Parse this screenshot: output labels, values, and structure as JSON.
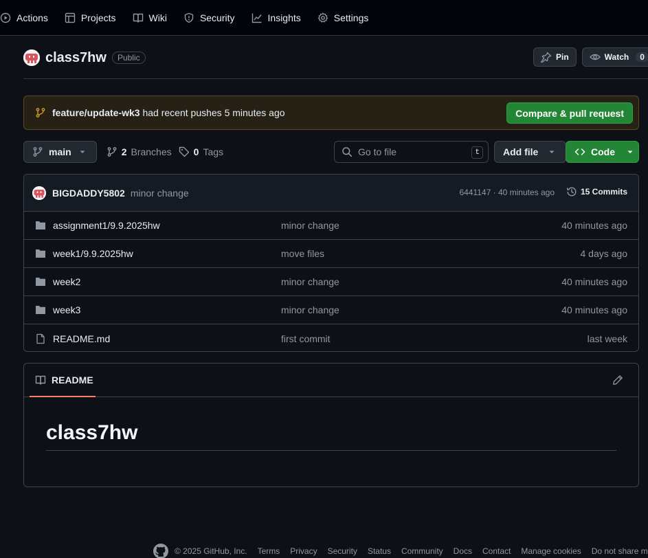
{
  "nav": {
    "items": [
      {
        "label": "Actions",
        "icon": "play-circle-icon"
      },
      {
        "label": "Projects",
        "icon": "table-icon"
      },
      {
        "label": "Wiki",
        "icon": "book-icon"
      },
      {
        "label": "Security",
        "icon": "shield-icon"
      },
      {
        "label": "Insights",
        "icon": "graph-icon"
      },
      {
        "label": "Settings",
        "icon": "gear-icon"
      }
    ]
  },
  "repo": {
    "name": "class7hw",
    "visibility": "Public",
    "pin_label": "Pin",
    "watch_label": "Watch",
    "watch_count": "0"
  },
  "push_banner": {
    "branch": "feature/update-wk3",
    "message": "had recent pushes 5 minutes ago",
    "button_label": "Compare & pull request"
  },
  "toolbar": {
    "branch": "main",
    "branches_count": "2",
    "branches_label": "Branches",
    "tags_count": "0",
    "tags_label": "Tags",
    "goto_placeholder": "Go to file",
    "goto_shortcut": "t",
    "add_file_label": "Add file",
    "code_label": "Code"
  },
  "latest_commit": {
    "author": "BIGDADDY5802",
    "message": "minor change",
    "meta": "6441147 · 40 minutes ago",
    "commits_label": "15 Commits"
  },
  "files": [
    {
      "name": "assignment1/9.9.2025hw",
      "type": "folder",
      "message": "minor change",
      "date": "40 minutes ago"
    },
    {
      "name": "week1/9.9.2025hw",
      "type": "folder",
      "message": "move files",
      "date": "4 days ago"
    },
    {
      "name": "week2",
      "type": "folder",
      "message": "minor change",
      "date": "40 minutes ago"
    },
    {
      "name": "week3",
      "type": "folder",
      "message": "minor change",
      "date": "40 minutes ago"
    },
    {
      "name": "README.md",
      "type": "file",
      "message": "first commit",
      "date": "last week"
    }
  ],
  "readme": {
    "tab_label": "README",
    "heading": "class7hw"
  },
  "footer": {
    "copyright": "© 2025 GitHub, Inc.",
    "links": [
      "Terms",
      "Privacy",
      "Security",
      "Status",
      "Community",
      "Docs",
      "Contact",
      "Manage cookies",
      "Do not share my"
    ]
  },
  "colors": {
    "background": "#0d1117",
    "accent_green": "#238636",
    "banner_bg": "#272115",
    "tab_underline": "#f78166"
  }
}
